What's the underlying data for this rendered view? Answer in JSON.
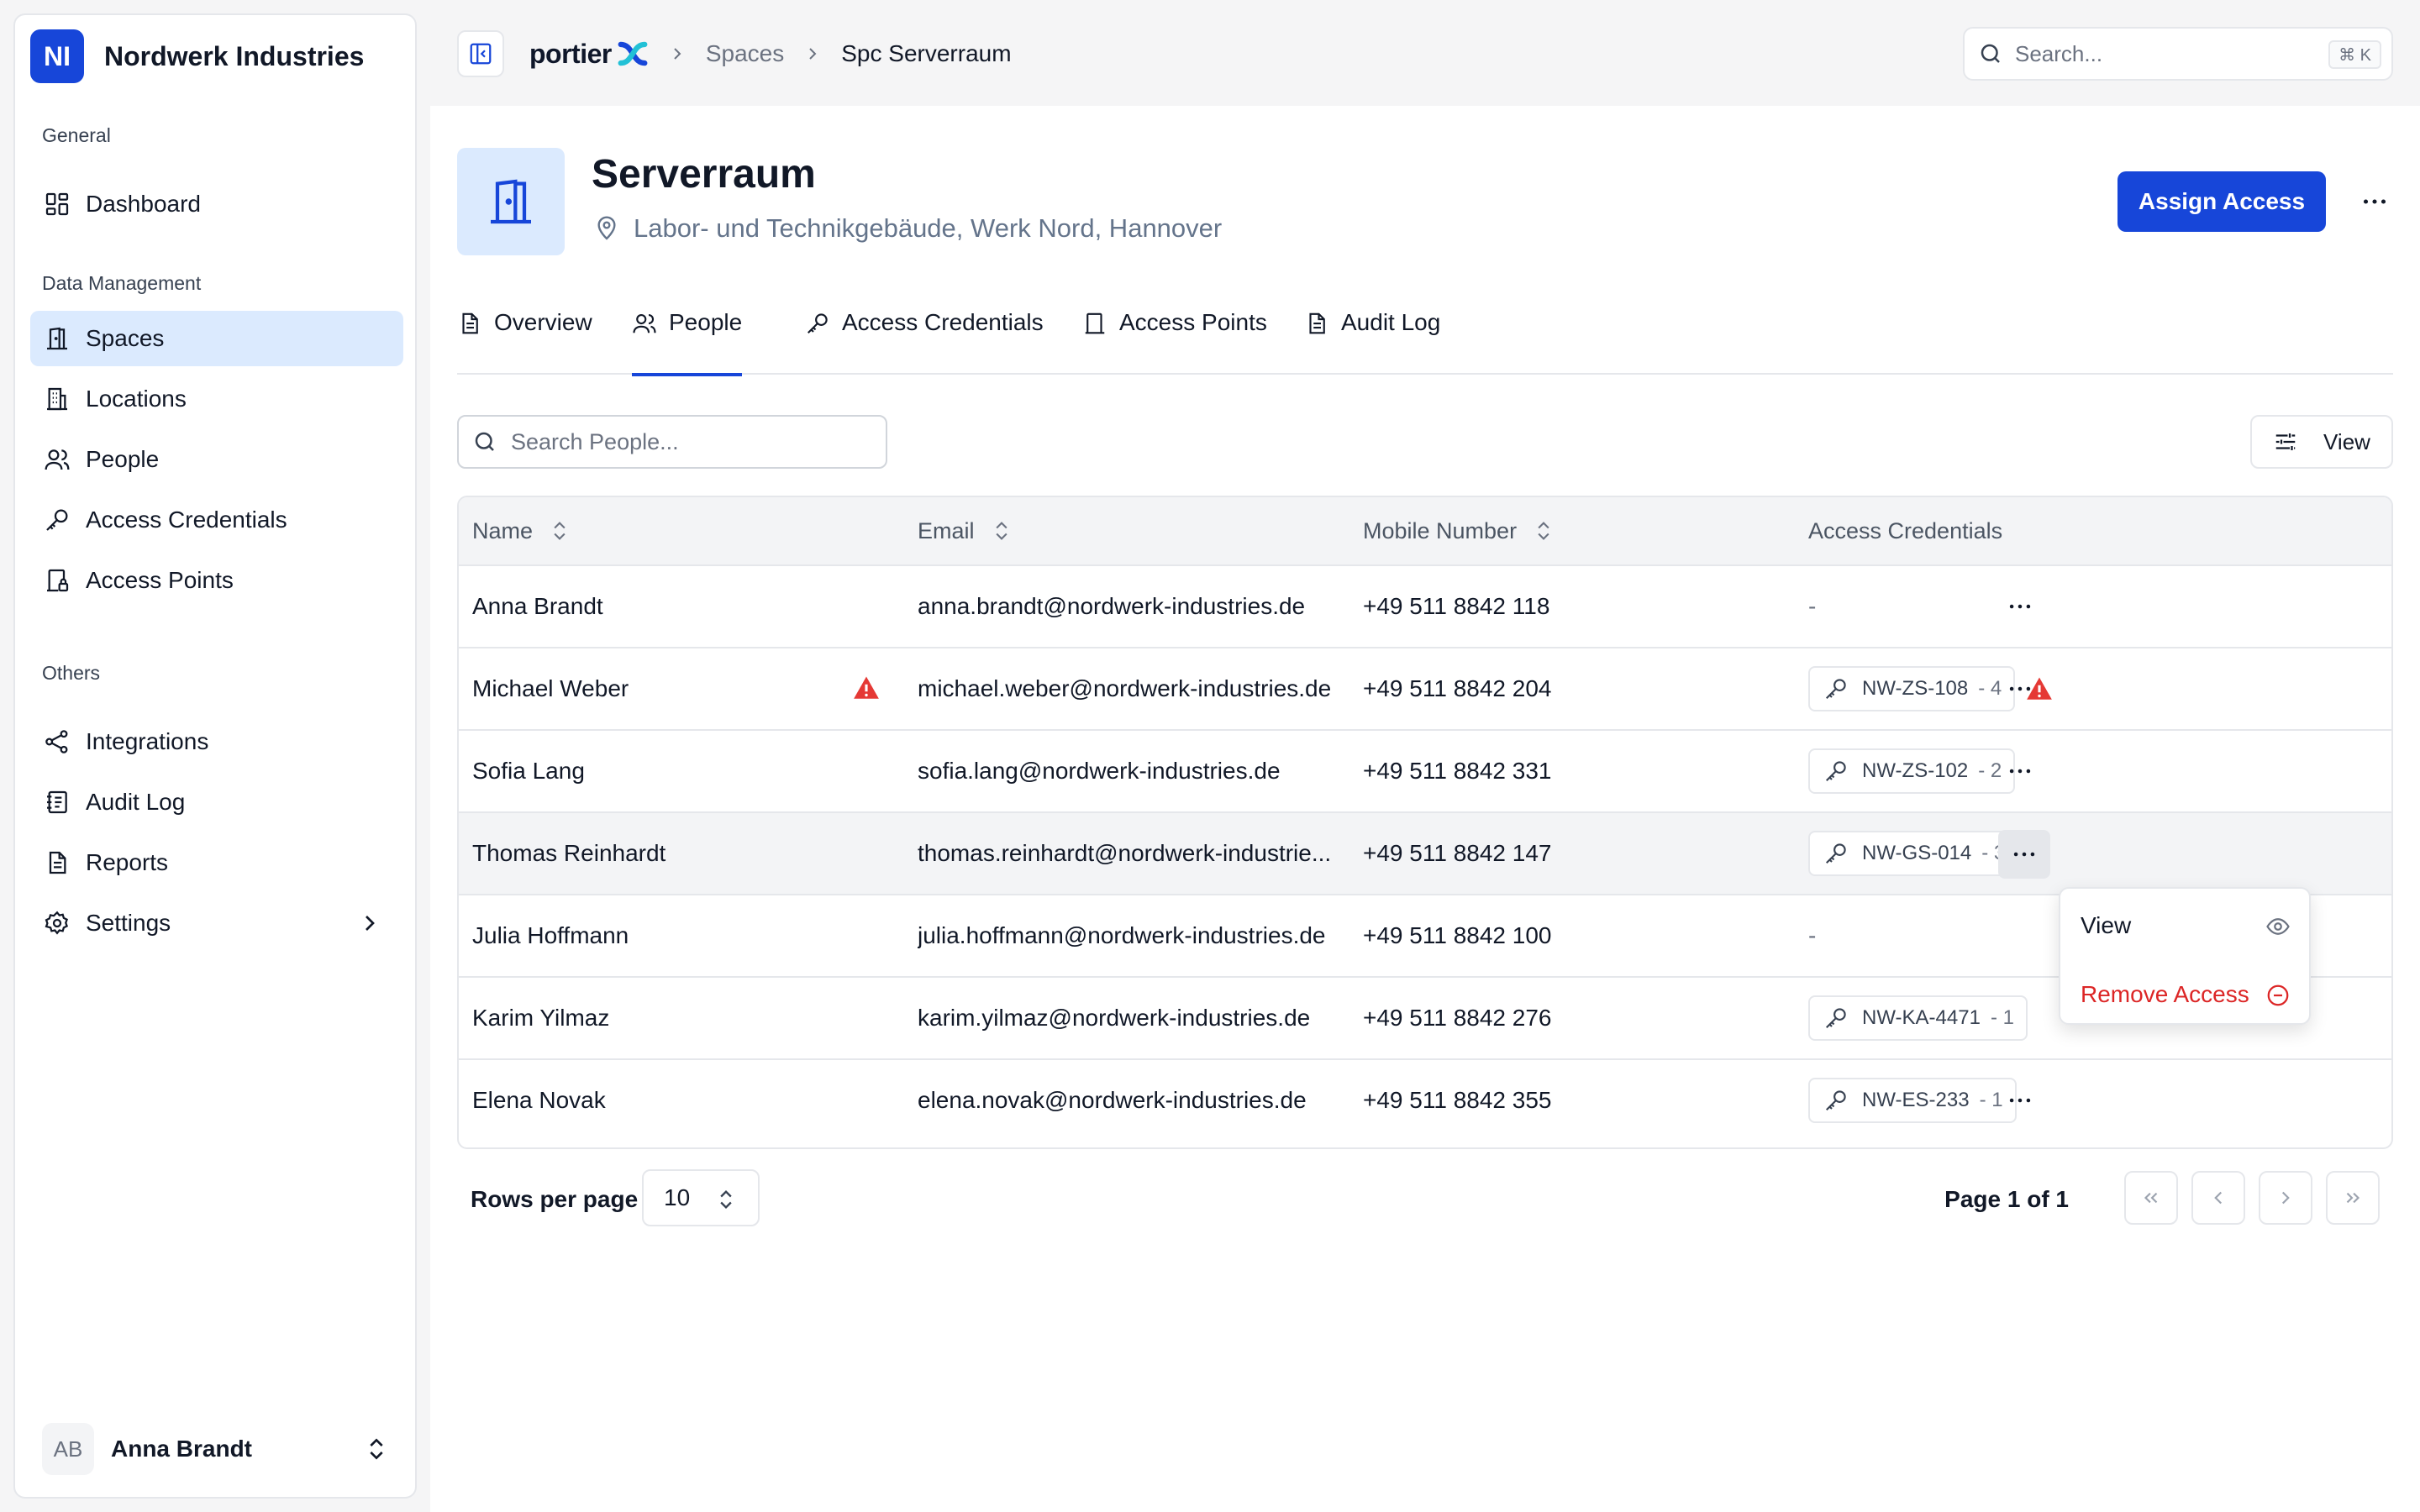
{
  "org": {
    "initials": "NI",
    "name": "Nordwerk Industries"
  },
  "sidebar": {
    "groups": [
      {
        "label": "General",
        "items": [
          {
            "label": "Dashboard",
            "icon": "dashboard-icon"
          }
        ]
      },
      {
        "label": "Data Management",
        "items": [
          {
            "label": "Spaces",
            "icon": "door-icon",
            "active": true
          },
          {
            "label": "Locations",
            "icon": "building-icon"
          },
          {
            "label": "People",
            "icon": "users-icon"
          },
          {
            "label": "Access Credentials",
            "icon": "key-icon"
          },
          {
            "label": "Access Points",
            "icon": "access-point-icon"
          }
        ]
      },
      {
        "label": "Others",
        "items": [
          {
            "label": "Integrations",
            "icon": "share-icon"
          },
          {
            "label": "Audit Log",
            "icon": "log-icon"
          },
          {
            "label": "Reports",
            "icon": "file-icon"
          },
          {
            "label": "Settings",
            "icon": "gear-icon"
          }
        ]
      }
    ],
    "user": {
      "initials": "AB",
      "name": "Anna Brandt"
    }
  },
  "topbar": {
    "logo_text": "portier",
    "breadcrumbs": [
      "Spaces",
      "Spc Serverraum"
    ],
    "search_placeholder": "Search...",
    "shortcut": "⌘ K"
  },
  "space": {
    "title": "Serverraum",
    "location": "Labor- und Technikgebäude, Werk Nord, Hannover",
    "assign_label": "Assign Access"
  },
  "tabs": [
    {
      "label": "Overview",
      "icon": "document-icon"
    },
    {
      "label": "People",
      "icon": "users-icon",
      "active": true
    },
    {
      "label": "Access Credentials",
      "icon": "key-icon"
    },
    {
      "label": "Access Points",
      "icon": "access-point-icon"
    },
    {
      "label": "Audit Log",
      "icon": "log-icon"
    }
  ],
  "people_search_placeholder": "Search People...",
  "view_label": "View",
  "table": {
    "columns": [
      "Name",
      "Email",
      "Mobile Number",
      "Access Credentials"
    ],
    "rows": [
      {
        "name": "Anna Brandt",
        "email": "anna.brandt@nordwerk-industries.de",
        "mobile": "+49 511 8842 118",
        "credential": "-"
      },
      {
        "name": "Michael Weber",
        "email": "michael.weber@nordwerk-industries.de",
        "mobile": "+49 511 8842 204",
        "credential": "NW-ZS-108",
        "count": "- 4",
        "warning": true
      },
      {
        "name": "Sofia Lang",
        "email": "sofia.lang@nordwerk-industries.de",
        "mobile": "+49 511 8842 331",
        "credential": "NW-ZS-102",
        "count": "- 2"
      },
      {
        "name": "Thomas Reinhardt",
        "email": "thomas.reinhardt@nordwerk-industrie...",
        "mobile": "+49 511 8842 147",
        "credential": "NW-GS-014",
        "count": "- 3",
        "highlighted": true
      },
      {
        "name": "Julia Hoffmann",
        "email": "julia.hoffmann@nordwerk-industries.de",
        "mobile": "+49 511 8842 100",
        "credential": "-"
      },
      {
        "name": "Karim Yilmaz",
        "email": "karim.yilmaz@nordwerk-industries.de",
        "mobile": "+49 511 8842 276",
        "credential": "NW-KA-4471",
        "count": "- 1"
      },
      {
        "name": "Elena Novak",
        "email": "elena.novak@nordwerk-industries.de",
        "mobile": "+49 511 8842 355",
        "credential": "NW-ES-233",
        "count": "- 1"
      }
    ]
  },
  "row_menu": {
    "view_label": "View",
    "remove_label": "Remove Access"
  },
  "pagination": {
    "rows_per_page_label": "Rows per page",
    "rows_per_page": "10",
    "page_info": "Page 1 of 1"
  },
  "colors": {
    "accent": "#1746d9",
    "active_bg": "#dbeafe",
    "danger": "#dc2626"
  }
}
